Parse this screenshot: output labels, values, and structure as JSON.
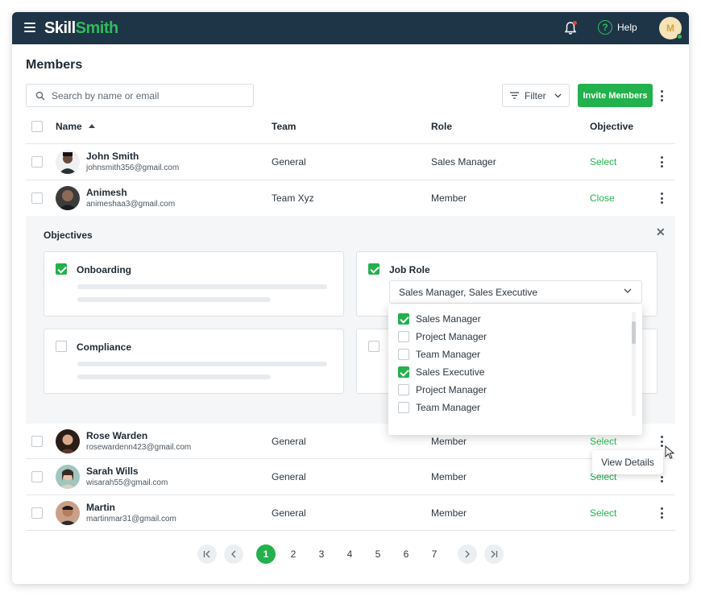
{
  "app": {
    "logo_part1": "Skill",
    "logo_part2": "Smith",
    "help_label": "Help",
    "avatar_initial": "M"
  },
  "page": {
    "title": "Members"
  },
  "toolbar": {
    "search_placeholder": "Search by name or email",
    "filter_label": "Filter",
    "invite_label": "Invite Members"
  },
  "table": {
    "headers": {
      "name": "Name",
      "team": "Team",
      "role": "Role",
      "objective": "Objective"
    },
    "rows": [
      {
        "name": "John Smith",
        "email": "johnsmith356@gmail.com",
        "team": "General",
        "role": "Sales Manager",
        "objective": "Select"
      },
      {
        "name": "Animesh",
        "email": "animeshaa3@gmail.com",
        "team": "Team Xyz",
        "role": "Member",
        "objective": "Close"
      },
      {
        "name": "Rose Warden",
        "email": "rosewardenn423@gmail.com",
        "team": "General",
        "role": "Member",
        "objective": "Select"
      },
      {
        "name": "Sarah Wills",
        "email": "wisarah55@gmail.com",
        "team": "General",
        "role": "Member",
        "objective": "Select"
      },
      {
        "name": "Martin",
        "email": "martinmar31@gmail.com",
        "team": "General",
        "role": "Member",
        "objective": "Select"
      }
    ]
  },
  "objectives": {
    "title": "Objectives",
    "cards": [
      {
        "label": "Onboarding",
        "checked": true
      },
      {
        "label": "Job Role",
        "checked": true
      },
      {
        "label": "Compliance",
        "checked": false
      }
    ],
    "job_role_select": {
      "value": "Sales Manager, Sales Executive",
      "options": [
        {
          "label": "Sales Manager",
          "checked": true
        },
        {
          "label": "Project Manager",
          "checked": false
        },
        {
          "label": "Team Manager",
          "checked": false
        },
        {
          "label": "Sales Executive",
          "checked": true
        },
        {
          "label": "Project Manager",
          "checked": false
        },
        {
          "label": "Team Manager",
          "checked": false
        }
      ]
    }
  },
  "context_menu": {
    "view_details": "View Details"
  },
  "pagination": {
    "pages": [
      "1",
      "2",
      "3",
      "4",
      "5",
      "6",
      "7"
    ],
    "current": "1"
  },
  "colors": {
    "topbar": "#1e3447",
    "accent": "#22b14c",
    "panel_bg": "#f4f6f7"
  }
}
